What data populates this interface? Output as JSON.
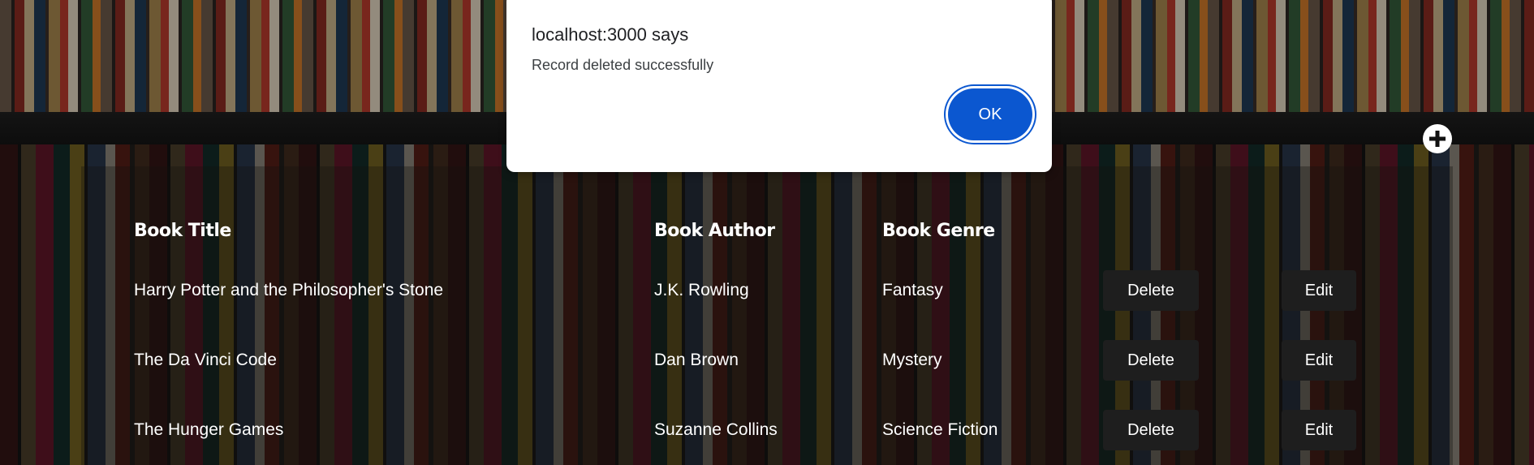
{
  "dialog": {
    "title": "localhost:3000 says",
    "message": "Record deleted successfully",
    "ok_label": "OK"
  },
  "toolbar": {
    "add_icon": "plus-circle-icon"
  },
  "table": {
    "headers": [
      "Book Title",
      "Book Author",
      "Book Genre"
    ],
    "rows": [
      {
        "title": "Harry Potter and the Philosopher's Stone",
        "author": "J.K. Rowling",
        "genre": "Fantasy",
        "delete_label": "Delete",
        "edit_label": "Edit"
      },
      {
        "title": "The Da Vinci Code",
        "author": "Dan Brown",
        "genre": "Mystery",
        "delete_label": "Delete",
        "edit_label": "Edit"
      },
      {
        "title": "The Hunger Games",
        "author": "Suzanne Collins",
        "genre": "Science Fiction",
        "delete_label": "Delete",
        "edit_label": "Edit"
      }
    ]
  },
  "colors": {
    "accent": "#0b57d0",
    "button_bg": "#1e1e1e",
    "text": "#ffffff"
  }
}
